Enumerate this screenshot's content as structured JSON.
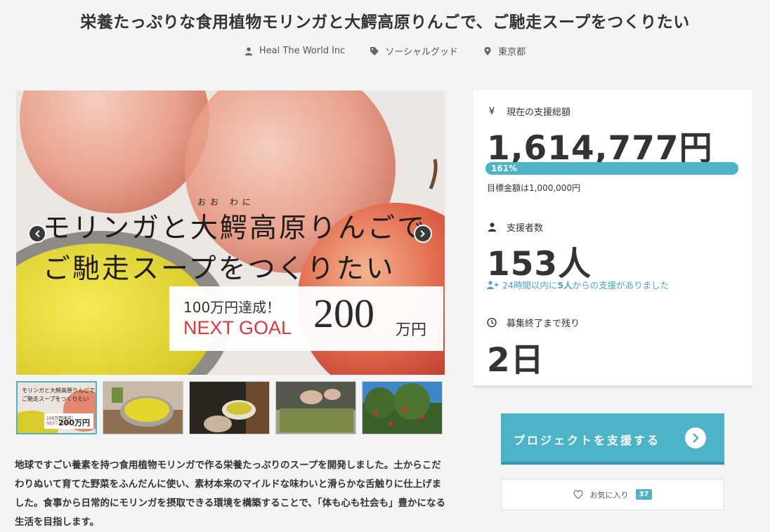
{
  "project": {
    "title": "栄養たっぷりな食用植物モリンガと大鰐高原りんごで、ご馳走スープをつくりたい",
    "owner": "Heal The World Inc",
    "category": "ソーシャルグッド",
    "location": "東京都"
  },
  "hero": {
    "ruby": "おお わに",
    "headline_line1": "モリンガと大鰐高原りんごで",
    "headline_line2": "ご馳走スープをつくりたい",
    "goal_achieved": "100万円達成！",
    "next_goal_label": "NEXT GOAL",
    "next_goal_amount": "200",
    "next_goal_unit": "万円"
  },
  "thumbnails": {
    "first_text_line1": "モリンガと大鰐高原りんごで",
    "first_text_line2": "ご馳走スープをつくりたい",
    "first_next_goal": "NEXT GOAL",
    "first_amount": "200万円",
    "first_achieved": "100万円達成！"
  },
  "description": "地球ですごい養素を持つ食用植物モリンガで作る栄養たっぷりのスープを開発しました。土からこだわりぬいて育てた野菜をふんだんに使い、素材本来のマイルドな味わいと滑らかな舌触りに仕上げました。食事から日常的にモリンガを摂取できる環境を構築することで、「体も心も社会も」豊かになる生活を目指します。",
  "stats": {
    "currency_icon": "¥",
    "total_label": "現在の支援総額",
    "total_amount": "1,614,777円",
    "progress_percent": 161,
    "progress_label": "161%",
    "goal_text": "目標金額は1,000,000円",
    "backers_label": "支援者数",
    "backers_count": "153人",
    "recent_prefix": "24時間以内に",
    "recent_count": "5人",
    "recent_suffix": "からの支援がありました",
    "remaining_label": "募集終了まで残り",
    "remaining_value": "2日"
  },
  "actions": {
    "support_label": "プロジェクトを支援する",
    "favorite_label": "お気に入り",
    "favorite_count": "37"
  },
  "colors": {
    "accent": "#4db3c7",
    "next_goal_red": "#d8393e",
    "text": "#333333"
  }
}
